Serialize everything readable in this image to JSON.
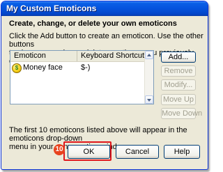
{
  "window": {
    "title": "My Custom Emoticons"
  },
  "heading": "Create, change, or delete your own emoticons",
  "instructions": "Click the Add button to create an emoticon. Use the other buttons\nto change, reorder, or delete emoticons you previously created.",
  "list": {
    "columns": [
      "Emoticon",
      "Keyboard Shortcut"
    ],
    "rows": [
      {
        "icon": "money-face-emoticon-icon",
        "name": "Money face",
        "shortcut": "$-)"
      }
    ]
  },
  "side_buttons": {
    "add": "Add...",
    "remove": "Remove",
    "modify": "Modify...",
    "move_up": "Move Up",
    "move_down": "Move Down"
  },
  "footer_note": "The first 10 emoticons listed above will appear in the emoticons drop-down\nmenu in your conversation window.",
  "bottom_buttons": {
    "ok": "OK",
    "cancel": "Cancel",
    "help": "Help"
  },
  "annotation": {
    "step_number": "10",
    "highlight_color": "#e0161b",
    "badge_color": "#e8431e"
  },
  "colors": {
    "titlebar": "#0453dd",
    "dialog_bg": "#ece9d8"
  }
}
